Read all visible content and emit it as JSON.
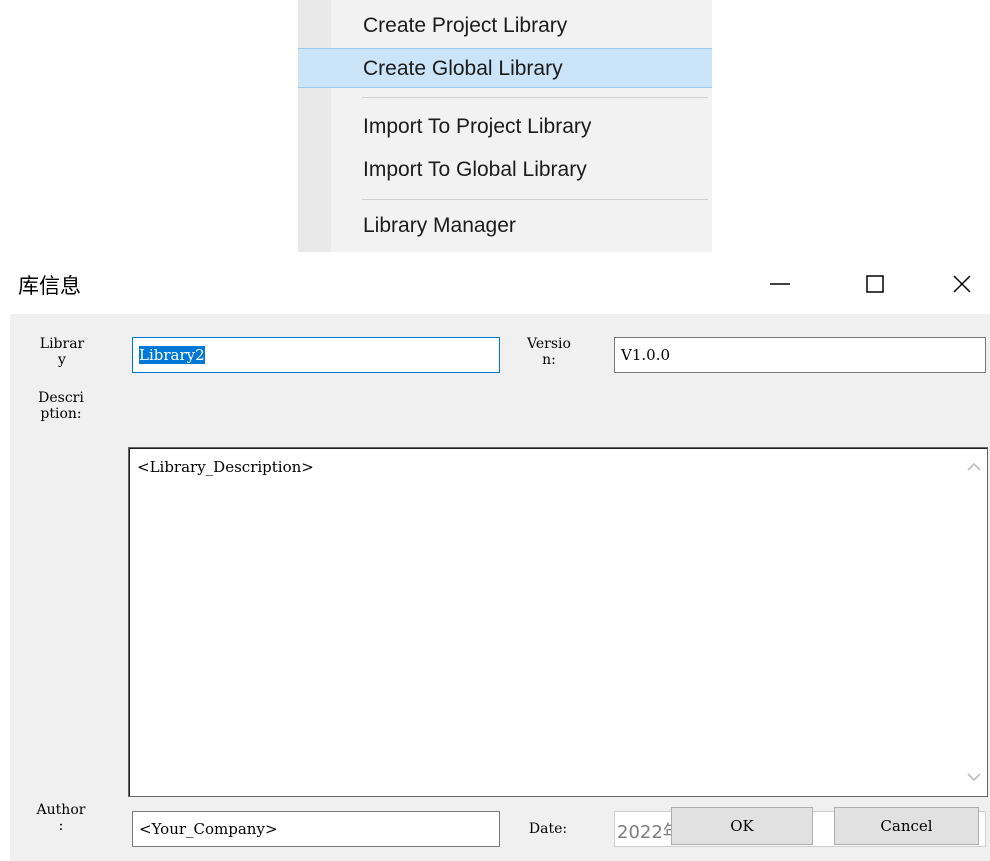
{
  "menu": {
    "items": [
      {
        "label": "Create Project Library"
      },
      {
        "label": "Create Global Library"
      },
      {
        "label": "Import To Project Library"
      },
      {
        "label": "Import To Global Library"
      },
      {
        "label": "Library Manager"
      }
    ]
  },
  "dialog": {
    "title": "库信息",
    "labels": {
      "library": "Librar\ny",
      "version": "Versio\nn:",
      "description": "Descri\nption:",
      "author": "Author\n:",
      "date": "Date:"
    },
    "fields": {
      "library_name": "Library2",
      "version": "V1.0.0",
      "description": "<Library_Description>",
      "author": "<Your_Company>",
      "date": "2022年 7月 4日"
    },
    "buttons": {
      "ok": "OK",
      "cancel": "Cancel"
    }
  },
  "colors": {
    "accent": "#0078d7",
    "menu_highlight": "#cce4f7"
  }
}
